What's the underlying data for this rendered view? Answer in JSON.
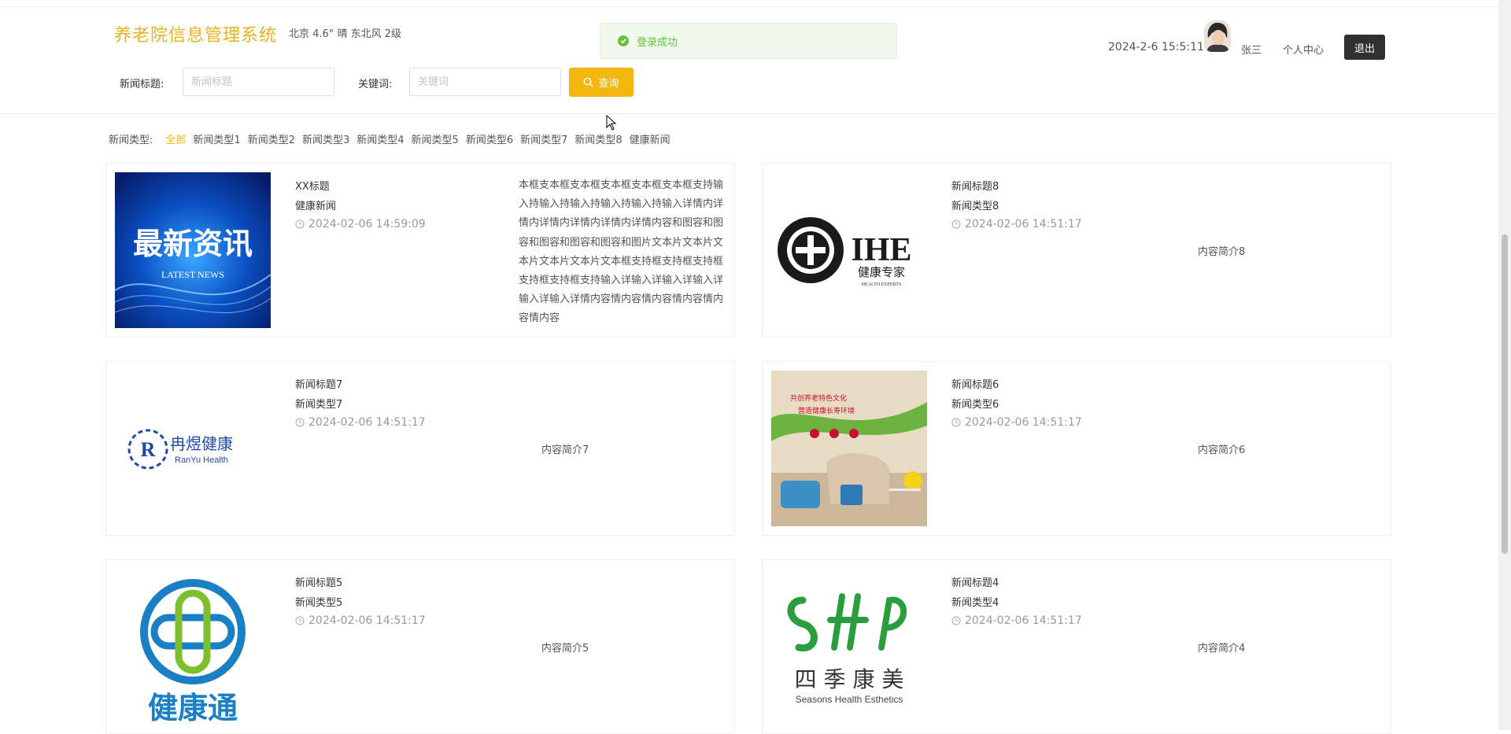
{
  "header": {
    "title": "养老院信息管理系统",
    "weather": "北京  4.6°  晴  东北风  2级",
    "datetime": "2024-2-6 15:5:11",
    "username": "张三",
    "profile_label": "个人中心",
    "logout_label": "退出"
  },
  "toast": {
    "message": "登录成功",
    "color": "#67c23a"
  },
  "search": {
    "title_label": "新闻标题:",
    "title_placeholder": "新闻标题",
    "keyword_label": "关键词:",
    "keyword_placeholder": "关键词",
    "button_label": "查询",
    "button_color": "#f5b70e"
  },
  "filter": {
    "label": "新闻类型:",
    "active": "全部",
    "types": [
      "全部",
      "新闻类型1",
      "新闻类型2",
      "新闻类型3",
      "新闻类型4",
      "新闻类型5",
      "新闻类型6",
      "新闻类型7",
      "新闻类型8",
      "健康新闻"
    ]
  },
  "news": [
    {
      "title": "XX标题",
      "type": "健康新闻",
      "time": "2024-02-06 14:59:09",
      "desc": "本框支本框支本框支本框支本框支本框支持输入持输入持输入持输入持输入持输入详情内详情内详情内详情内详情内详情内容和图容和图容和图容和图容和图容和图片文本片文本片文本片文本片文本片文本框支持框支持框支持框支持框支持框支持输入详输入详输入详输入详输入详输入详情内容情内容情内容情内容情内容情内容",
      "image": "latest-news"
    },
    {
      "title": "新闻标题8",
      "type": "新闻类型8",
      "time": "2024-02-06 14:51:17",
      "desc": "内容简介8",
      "image": "ihe-logo"
    },
    {
      "title": "新闻标题7",
      "type": "新闻类型7",
      "time": "2024-02-06 14:51:17",
      "desc": "内容简介7",
      "image": "ranyu-logo"
    },
    {
      "title": "新闻标题6",
      "type": "新闻类型6",
      "time": "2024-02-06 14:51:17",
      "desc": "内容简介6",
      "image": "room-photo"
    },
    {
      "title": "新闻标题5",
      "type": "新闻类型5",
      "time": "2024-02-06 14:51:17",
      "desc": "内容简介5",
      "image": "jiankangtong-logo"
    },
    {
      "title": "新闻标题4",
      "type": "新闻类型4",
      "time": "2024-02-06 14:51:17",
      "desc": "内容简介4",
      "image": "seasons-logo"
    }
  ],
  "images": {
    "latest_news_cn": "最新资讯",
    "latest_news_en": "LATEST NEWS",
    "ihe_main": "IHE",
    "ihe_cn": "健康专家",
    "ihe_en": "HEALTH EXPERTS",
    "ranyu_cn": "冉煜健康",
    "ranyu_en": "RanYu  Health",
    "jkt_cn": "健康通",
    "seasons_cn": "四 季 康 美",
    "seasons_en": "Seasons Health Esthetics",
    "room_banner_1": "共创养老特色文化",
    "room_banner_2": "营造健康长寿环境"
  }
}
